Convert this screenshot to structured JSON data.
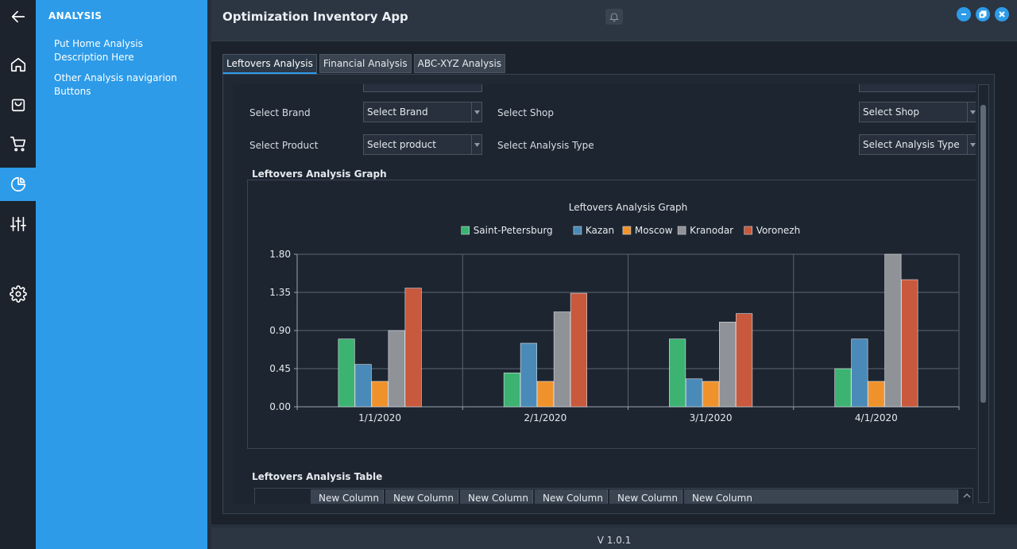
{
  "sidebar": {
    "title": "ANALYSIS",
    "items": [
      {
        "label": "Put Home Analysis Description Here"
      },
      {
        "label": "Other Analysis navigarion Buttons"
      }
    ]
  },
  "rail": {
    "icons": [
      "back-arrow-icon",
      "home-icon",
      "shopping-bag-icon",
      "cart-icon",
      "pie-chart-icon",
      "sliders-icon",
      "gear-icon"
    ],
    "active": "pie-chart-icon"
  },
  "header": {
    "title": "Optimization Inventory App"
  },
  "tabs": [
    {
      "label": "Leftovers Analysis",
      "active": true
    },
    {
      "label": "Financial Analysis",
      "active": false
    },
    {
      "label": "ABC-XYZ Analysis",
      "active": false
    }
  ],
  "filters": {
    "brand_label": "Select Brand",
    "brand_value": "Select Brand",
    "shop_label": "Select Shop",
    "shop_value": "Select Shop",
    "product_label": "Select Product",
    "product_value": "Select product",
    "analysis_type_label": "Select Analysis Type",
    "analysis_type_value": "Select Analysis Type"
  },
  "graph_section_title": "Leftovers Analysis Graph",
  "table_section_title": "Leftovers Analysis Table",
  "table": {
    "columns": [
      "New Column",
      "New Column",
      "New Column",
      "New Column",
      "New Column",
      "New Column"
    ]
  },
  "footer": {
    "version": "V 1.0.1"
  },
  "colors": {
    "accent": "#2d9be8",
    "series": [
      "#3cb371",
      "#4a8ab8",
      "#f0922b",
      "#8f9297",
      "#c8593c"
    ]
  },
  "chart_data": {
    "type": "bar",
    "title": "Leftovers Analysis Graph",
    "categories": [
      "1/1/2020",
      "2/1/2020",
      "3/1/2020",
      "4/1/2020"
    ],
    "series": [
      {
        "name": "Saint-Petersburg",
        "values": [
          0.8,
          0.4,
          0.8,
          0.45
        ]
      },
      {
        "name": "Kazan",
        "values": [
          0.5,
          0.75,
          0.33,
          0.8
        ]
      },
      {
        "name": "Moscow",
        "values": [
          0.3,
          0.3,
          0.3,
          0.3
        ]
      },
      {
        "name": "Kranodar",
        "values": [
          0.9,
          1.12,
          1.0,
          1.8
        ]
      },
      {
        "name": "Voronezh",
        "values": [
          1.4,
          1.34,
          1.1,
          1.5
        ]
      }
    ],
    "yticks": [
      "0.00",
      "0.45",
      "0.90",
      "1.35",
      "1.80"
    ],
    "ylim": [
      0,
      1.8
    ],
    "grid": true,
    "legend": "top-center"
  }
}
